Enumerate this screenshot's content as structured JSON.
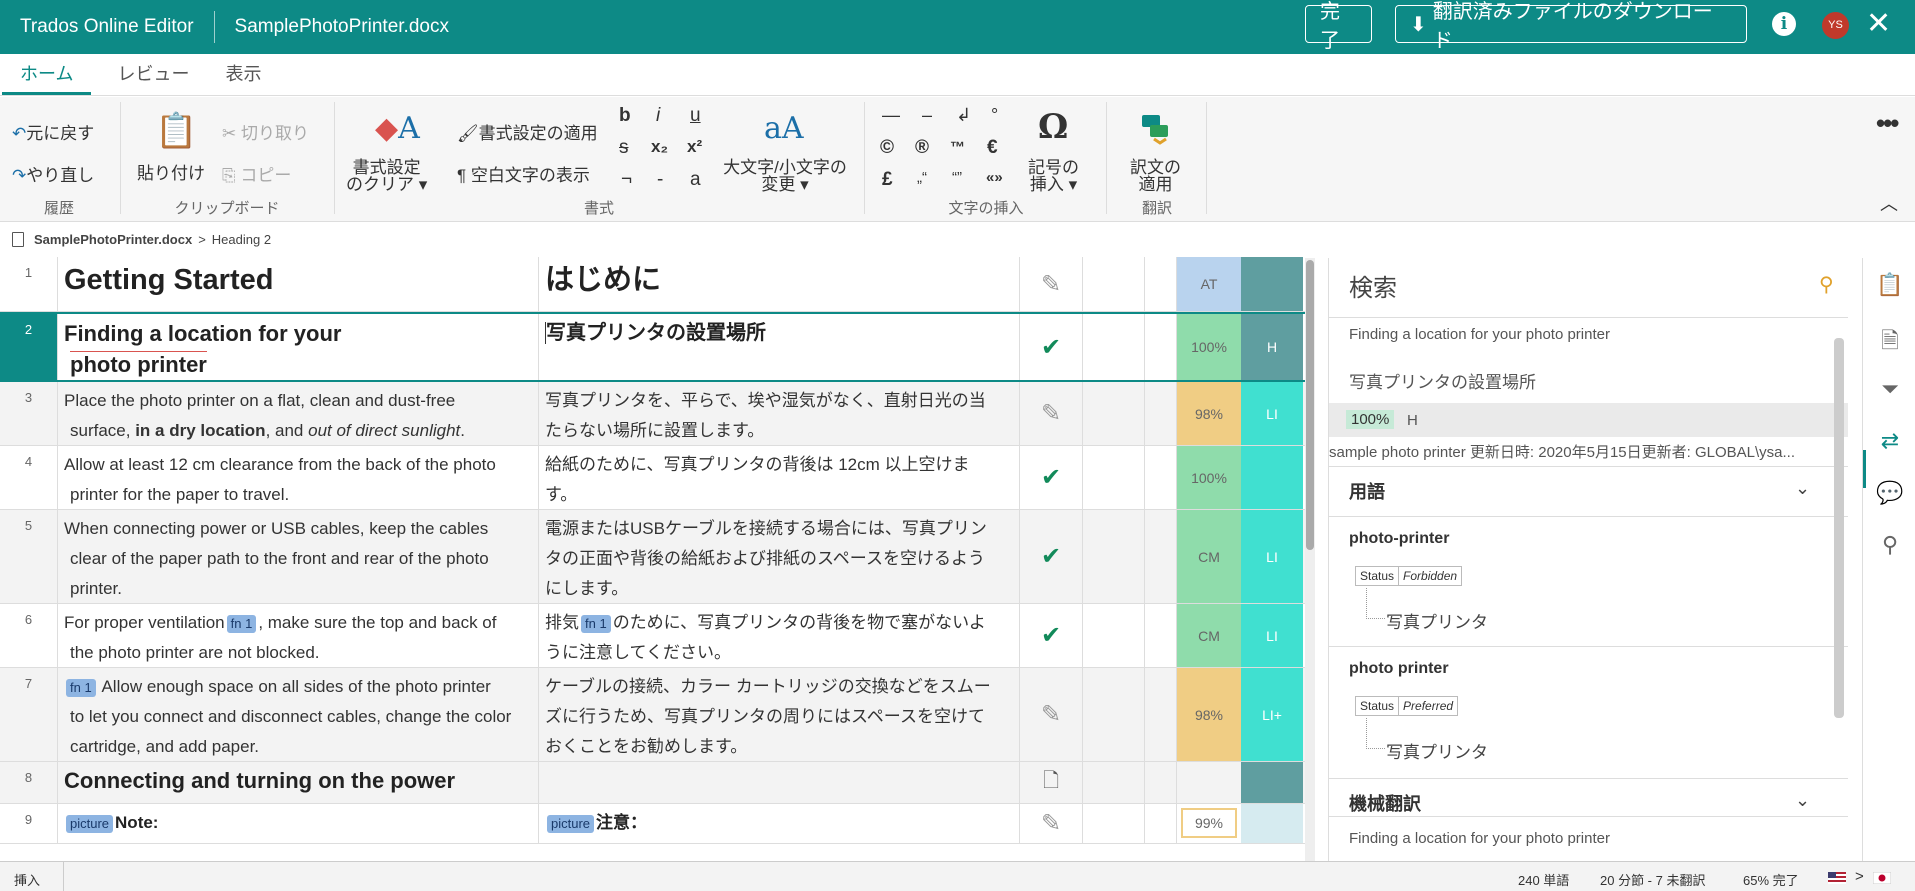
{
  "app": {
    "title": "Trados Online Editor",
    "document": "SamplePhotoPrinter.docx",
    "done": "完了",
    "download": "翻訳済みファイルのダウンロード",
    "avatar": "YS"
  },
  "tabs": [
    "ホーム",
    "レビュー",
    "表示"
  ],
  "ribbon": {
    "undo": "元に戻す",
    "redo": "やり直し",
    "history_group": "履歴",
    "paste": "貼り付け",
    "cut": "切り取り",
    "copy": "コピー",
    "clipboard_group": "クリップボード",
    "clear_format_1": "書式設定",
    "clear_format_2": "のクリア",
    "apply_format": "書式設定の適用",
    "show_whitespace": "空白文字の表示",
    "bold": "b",
    "italic": "i",
    "underline": "u",
    "strike": "s",
    "sub": "x₂",
    "sup": "x²",
    "sym1": "¬",
    "sym2": "-",
    "sym3": "a",
    "case_1": "大文字/小文字の",
    "case_2": "変更",
    "format_group": "書式",
    "ch_emdash": "—",
    "ch_endash": "–",
    "ch_return": "↲",
    "ch_deg": "°",
    "ch_copy": "©",
    "ch_reg": "®",
    "ch_tm": "™",
    "ch_euro": "€",
    "ch_pound": "£",
    "ch_q1": "„“",
    "ch_q2": "“”",
    "ch_q3": "«»",
    "insert_symbol_1": "記号の",
    "insert_symbol_2": "挿入",
    "insert_group": "文字の挿入",
    "apply_translation_1": "訳文の",
    "apply_translation_2": "適用",
    "translate_group": "翻訳"
  },
  "breadcrumb": {
    "file": "SamplePhotoPrinter.docx",
    "sep": ">",
    "section": "Heading 2"
  },
  "segments": [
    {
      "num": "1",
      "src": "Getting Started",
      "tgt": "はじめに",
      "status": "pencil",
      "match": "AT",
      "orig": ""
    },
    {
      "num": "2",
      "src_a": "Finding a location for your",
      "src_b": "photo printer",
      "tgt": "写真プリンタの設置場所",
      "status": "check",
      "match": "100%",
      "orig": "H"
    },
    {
      "num": "3",
      "src_a": "Place the photo printer on a flat, clean and dust-free",
      "src_b1": "surface, ",
      "src_b2": "in a dry location",
      "src_b3": ", and ",
      "src_b4": "out of direct sunlight",
      "src_b5": ".",
      "tgt_a": "写真プリンタを、平らで、埃や湿気がなく、直射日光の当",
      "tgt_b": "たらない場所に設置します。",
      "status": "pencil",
      "match": "98%",
      "orig": "LI"
    },
    {
      "num": "4",
      "src_a": "Allow at least 12 cm clearance from the back of the photo",
      "src_b": "printer for the paper to travel.",
      "tgt_a": "給紙のために、写真プリンタの背後は 12cm 以上空けま",
      "tgt_b": "す。",
      "status": "check",
      "match": "100%",
      "orig": ""
    },
    {
      "num": "5",
      "src_a": "When connecting power or USB cables, keep the cables",
      "src_b": "clear of the paper path to the front and rear of the photo",
      "src_c": "printer.",
      "tgt_a": "電源またはUSBケーブルを接続する場合には、写真プリン",
      "tgt_b": "タの正面や背後の給紙および排紙のスペースを空けるよう",
      "tgt_c": "にします。",
      "status": "check",
      "match": "CM",
      "orig": "LI"
    },
    {
      "num": "6",
      "src_a1": "For proper ventilation",
      "src_tag": "fn 1",
      "src_a2": ", make sure the top and back of",
      "src_b": "the photo printer are not blocked.",
      "tgt_a1": "排気",
      "tgt_tag": "fn 1",
      "tgt_a2": "のために、写真プリンタの背後を物で塞がないよ",
      "tgt_b": "うに注意してください。",
      "status": "check",
      "match": "CM",
      "orig": "LI"
    },
    {
      "num": "7",
      "src_tag": "fn 1",
      "src_a": " Allow enough space on all sides of the photo printer",
      "src_b": "to let you connect and disconnect cables, change the color",
      "src_c": "cartridge, and add paper.",
      "tgt_a": "ケーブルの接続、カラー カートリッジの交換などをスムー",
      "tgt_b": "ズに行うため、写真プリンタの周りにはスペースを空けて",
      "tgt_c": "おくことをお勧めします。",
      "status": "pencil",
      "match": "98%",
      "orig": "LI+"
    },
    {
      "num": "8",
      "src": "Connecting and turning on the power",
      "tgt": "",
      "status": "doc",
      "match": "",
      "orig": ""
    },
    {
      "num": "9",
      "src_tag": "picture",
      "src": "Note:",
      "tgt_tag": "picture",
      "tgt": "注意：",
      "status": "pencil",
      "match": "99%",
      "orig": ""
    }
  ],
  "panel": {
    "title": "検索",
    "source": "Finding a location for your photo printer",
    "target": "写真プリンタの設置場所",
    "pct": "100%",
    "origin": "H",
    "meta": "sample photo printer   更新日時: 2020年5月15日更新者: GLOBAL\\ysa...",
    "terms_title": "用語",
    "term1": "photo-printer",
    "term1_status_label": "Status",
    "term1_status": "Forbidden",
    "term1_target": "写真プリンタ",
    "term2": "photo printer",
    "term2_status_label": "Status",
    "term2_status": "Preferred",
    "term2_target": "写真プリンタ",
    "mt_title": "機械翻訳",
    "mt_source": "Finding a location for your photo printer"
  },
  "statusbar": {
    "mode": "挿入",
    "words": "240 単語",
    "segments": "20 分節 - 7 未翻訳",
    "complete": "65% 完了"
  },
  "colors": {
    "brand": "#0d8a86",
    "match_100": "#8fdcab",
    "match_98": "#f0cd84",
    "match_at": "#b9d3ee",
    "orig_li": "#40e0d0",
    "orig_h": "#5f9ea0"
  }
}
